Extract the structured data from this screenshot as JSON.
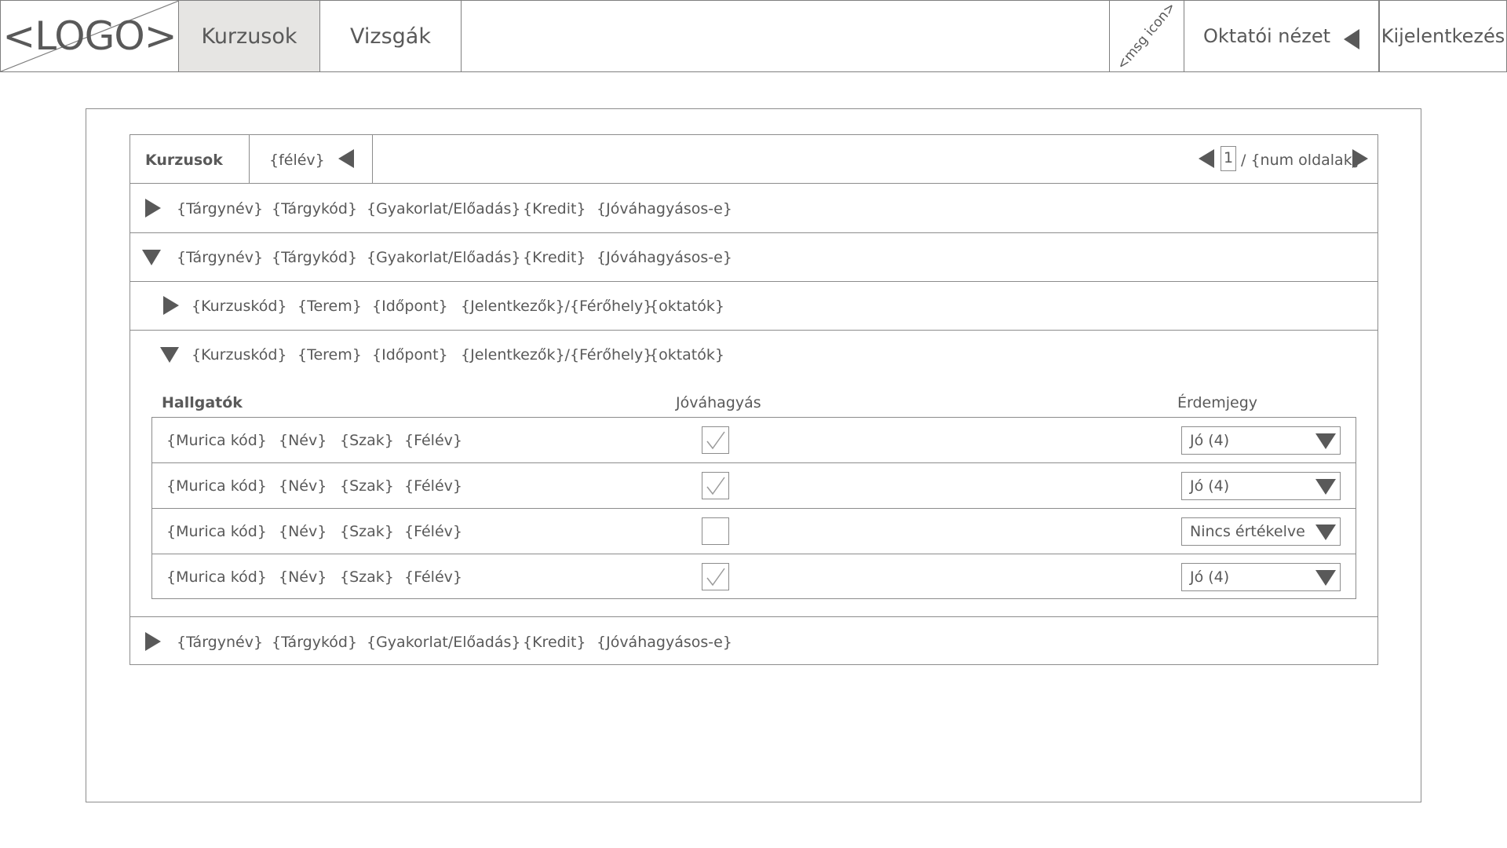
{
  "nav": {
    "logo": "<LOGO>",
    "tabs": [
      "Kurzusok",
      "Vizsgák"
    ],
    "msg_icon": "<msg icon>",
    "role_label": "Oktatói nézet",
    "logout_label": "Kijelentkezés"
  },
  "panel": {
    "title": "Kurzusok",
    "semester": "{félév}",
    "page_current": "1",
    "page_total": "/ {num oldalak}"
  },
  "subjects": [
    {
      "fields": [
        "{Tárgynév}",
        "{Tárgykód}",
        "{Gyakorlat/Előadás}",
        "{Kredit}",
        "{Jóváhagyásos-e}"
      ],
      "expanded": false
    },
    {
      "fields": [
        "{Tárgynév}",
        "{Tárgykód}",
        "{Gyakorlat/Előadás}",
        "{Kredit}",
        "{Jóváhagyásos-e}"
      ],
      "expanded": true
    },
    {
      "fields": [
        "{Tárgynév}",
        "{Tárgykód}",
        "{Gyakorlat/Előadás}",
        "{Kredit}",
        "{Jóváhagyásos-e}"
      ],
      "expanded": false
    }
  ],
  "courses": [
    {
      "fields": [
        "{Kurzuskód}",
        "{Terem}",
        "{Időpont}",
        "{Jelentkezők}/{Férőhely}",
        "{oktatók}"
      ],
      "expanded": false
    },
    {
      "fields": [
        "{Kurzuskód}",
        "{Terem}",
        "{Időpont}",
        "{Jelentkezők}/{Férőhely}",
        "{oktatók}"
      ],
      "expanded": true
    }
  ],
  "students": {
    "headers": {
      "students": "Hallgatók",
      "approval": "Jóváhagyás",
      "grade": "Érdemjegy"
    },
    "rows": [
      {
        "fields": [
          "{Murica kód}",
          "{Név}",
          "{Szak}",
          "{Félév}"
        ],
        "approved": true,
        "grade": "Jó (4)"
      },
      {
        "fields": [
          "{Murica kód}",
          "{Név}",
          "{Szak}",
          "{Félév}"
        ],
        "approved": true,
        "grade": "Jó (4)"
      },
      {
        "fields": [
          "{Murica kód}",
          "{Név}",
          "{Szak}",
          "{Félév}"
        ],
        "approved": false,
        "grade": "Nincs értékelve"
      },
      {
        "fields": [
          "{Murica kód}",
          "{Név}",
          "{Szak}",
          "{Félév}"
        ],
        "approved": true,
        "grade": "Jó (4)"
      }
    ]
  },
  "colors": {
    "line": "#8c8c8c",
    "text": "#595959",
    "active_tab": "#e6e5e3"
  }
}
